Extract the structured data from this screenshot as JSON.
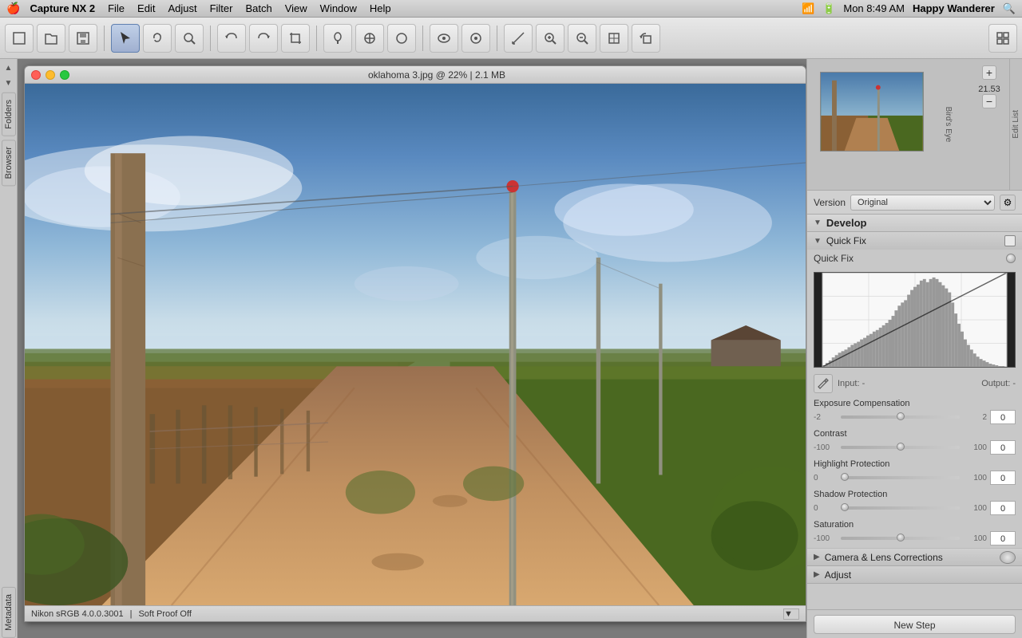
{
  "menubar": {
    "apple": "🍎",
    "app_name": "Capture NX 2",
    "menus": [
      "File",
      "Edit",
      "Adjust",
      "Filter",
      "Batch",
      "View",
      "Window",
      "Help"
    ],
    "clock": "Mon 8:49 AM",
    "username": "Happy Wanderer"
  },
  "window": {
    "title": "oklahoma 3.jpg @ 22% | 2.1 MB"
  },
  "status_bar": {
    "profile": "Nikon sRGB 4.0.0.3001",
    "proof": "Soft Proof Off"
  },
  "birds_eye": {
    "label": "Bird's Eye",
    "zoom_value": "21.53"
  },
  "right_panel": {
    "version_label": "Version",
    "version_value": "Original",
    "develop_title": "Develop",
    "quick_fix_label": "Quick Fix",
    "quick_fix_sublabel": "Quick Fix",
    "input_label": "Input: -",
    "output_label": "Output: -",
    "exposure_label": "Exposure Compensation",
    "exposure_min": "-2",
    "exposure_max": "2",
    "exposure_value": "0",
    "contrast_label": "Contrast",
    "contrast_min": "-100",
    "contrast_max": "100",
    "contrast_value": "0",
    "highlight_label": "Highlight Protection",
    "highlight_min": "0",
    "highlight_max": "100",
    "highlight_value": "0",
    "shadow_label": "Shadow Protection",
    "shadow_min": "0",
    "shadow_max": "100",
    "shadow_value": "0",
    "saturation_label": "Saturation",
    "saturation_min": "-100",
    "saturation_max": "100",
    "saturation_value": "0",
    "camera_lens_label": "Camera & Lens Corrections",
    "adjust_label": "Adjust",
    "new_step_label": "New Step"
  },
  "sidebar": {
    "folders_label": "Folders",
    "browser_label": "Browser",
    "metadata_label": "Metadata",
    "edit_list_label": "Edit List"
  }
}
